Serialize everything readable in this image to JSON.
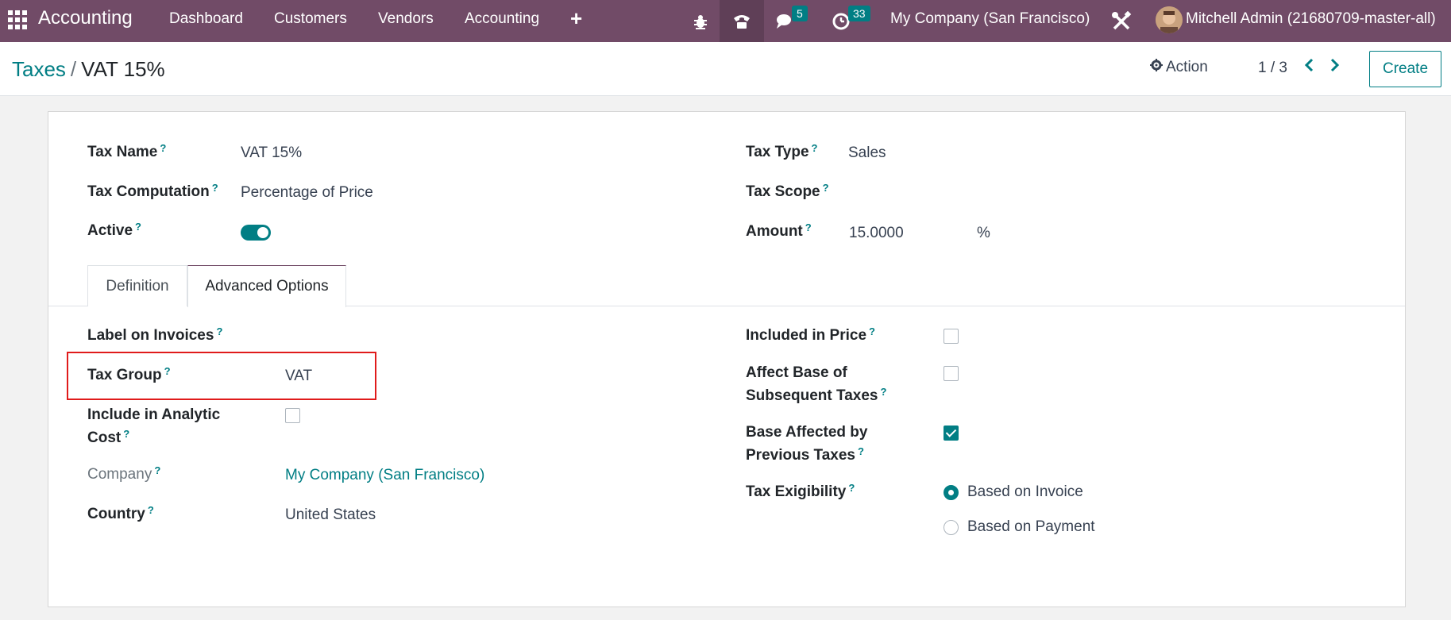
{
  "navbar": {
    "brand": "Accounting",
    "menu": [
      "Dashboard",
      "Customers",
      "Vendors",
      "Accounting"
    ],
    "messages_count": "5",
    "activities_count": "33",
    "company": "My Company (San Francisco)",
    "user": "Mitchell Admin (21680709-master-all)"
  },
  "breadcrumb": {
    "parent": "Taxes",
    "separator": "/",
    "current": "VAT 15%"
  },
  "controls": {
    "action_label": "Action",
    "pager": "1 / 3",
    "create_label": "Create"
  },
  "form": {
    "tax_name_label": "Tax Name",
    "tax_name_value": "VAT 15%",
    "tax_computation_label": "Tax Computation",
    "tax_computation_value": "Percentage of Price",
    "active_label": "Active",
    "active_value": true,
    "tax_type_label": "Tax Type",
    "tax_type_value": "Sales",
    "tax_scope_label": "Tax Scope",
    "tax_scope_value": "",
    "amount_label": "Amount",
    "amount_value": "15.0000",
    "amount_unit": "%"
  },
  "tabs": [
    "Definition",
    "Advanced Options"
  ],
  "active_tab": "Advanced Options",
  "advanced": {
    "label_on_invoices_label": "Label on Invoices",
    "label_on_invoices_value": "",
    "tax_group_label": "Tax Group",
    "tax_group_value": "VAT",
    "include_analytic_label_1": "Include in Analytic",
    "include_analytic_label_2": "Cost",
    "include_analytic_checked": false,
    "company_label": "Company",
    "company_value": "My Company (San Francisco)",
    "country_label": "Country",
    "country_value": "United States",
    "included_in_price_label": "Included in Price",
    "included_in_price_checked": false,
    "affect_base_label_1": "Affect Base of",
    "affect_base_label_2": "Subsequent Taxes",
    "affect_base_checked": false,
    "base_affected_label_1": "Base Affected by",
    "base_affected_label_2": "Previous Taxes",
    "base_affected_checked": true,
    "tax_exigibility_label": "Tax Exigibility",
    "exigibility_options": [
      "Based on Invoice",
      "Based on Payment"
    ],
    "exigibility_selected": "Based on Invoice"
  },
  "question_mark": "?",
  "colors": {
    "navbar": "#714B67",
    "accent": "#017e84",
    "highlight": "#e01b1b"
  }
}
